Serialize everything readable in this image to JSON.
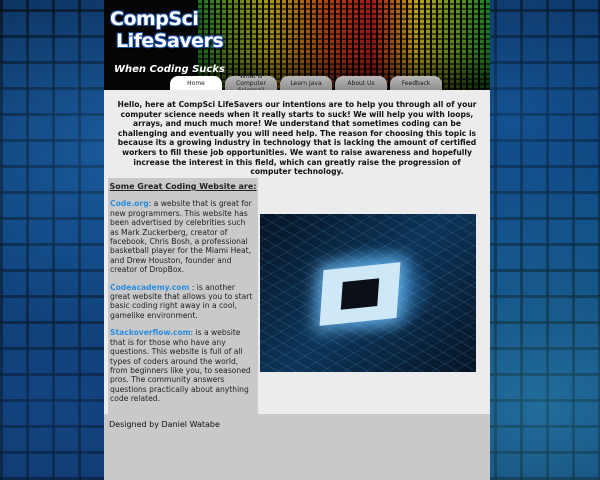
{
  "header": {
    "logo_line1": "CompSci",
    "logo_line2": "LifeSavers",
    "tagline": "When Coding Sucks"
  },
  "nav": {
    "tabs": [
      {
        "label": "Home",
        "active": true
      },
      {
        "label": "What is Computer Science?",
        "active": false
      },
      {
        "label": "Learn Java",
        "active": false
      },
      {
        "label": "About Us",
        "active": false
      },
      {
        "label": "Feedback",
        "active": false
      }
    ]
  },
  "main": {
    "intro": "Hello, here at CompSci LifeSavers our intentions are to help you through all of your computer science needs when it really starts to suck! We will help you with loops, arrays, and much much more! We understand that sometimes coding can be challenging and eventually you will need help. The reason for choosing this topic is because its a growing industry in technology that is lacking the amount of certified workers to fill these job opportunities. We want to raise awareness and hopefully increase the interest in this field, which can greatly raise the progression of computer technology."
  },
  "sidebar": {
    "title": "Some Great Coding Website are:",
    "sites": [
      {
        "name": "Code.org",
        "description": ": a website that is great for new programmers. This website has been advertised by celebrities such as Mark Zuckerberg, creator of facebook, Chris Bosh, a professional basketball player for the Miami Heat, and Drew Houston, founder and creator of DropBox."
      },
      {
        "name": "Codeacademy.com",
        "description": " : is another great website that allows you to start basic coding right away in a cool, gamelike environment."
      },
      {
        "name": "Stackoverflow.com",
        "description": ": is a website that is for those who have any questions. This website is full of all types of coders around the world, from beginners like you, to seasoned pros. The community answers questions practically about anything code related."
      }
    ]
  },
  "footer": {
    "credit": "Designed by Daniel Watabe"
  },
  "colors": {
    "link": "#2a8de0",
    "sidebar_bg": "#c9c9c9",
    "page_bg": "#ececec"
  }
}
